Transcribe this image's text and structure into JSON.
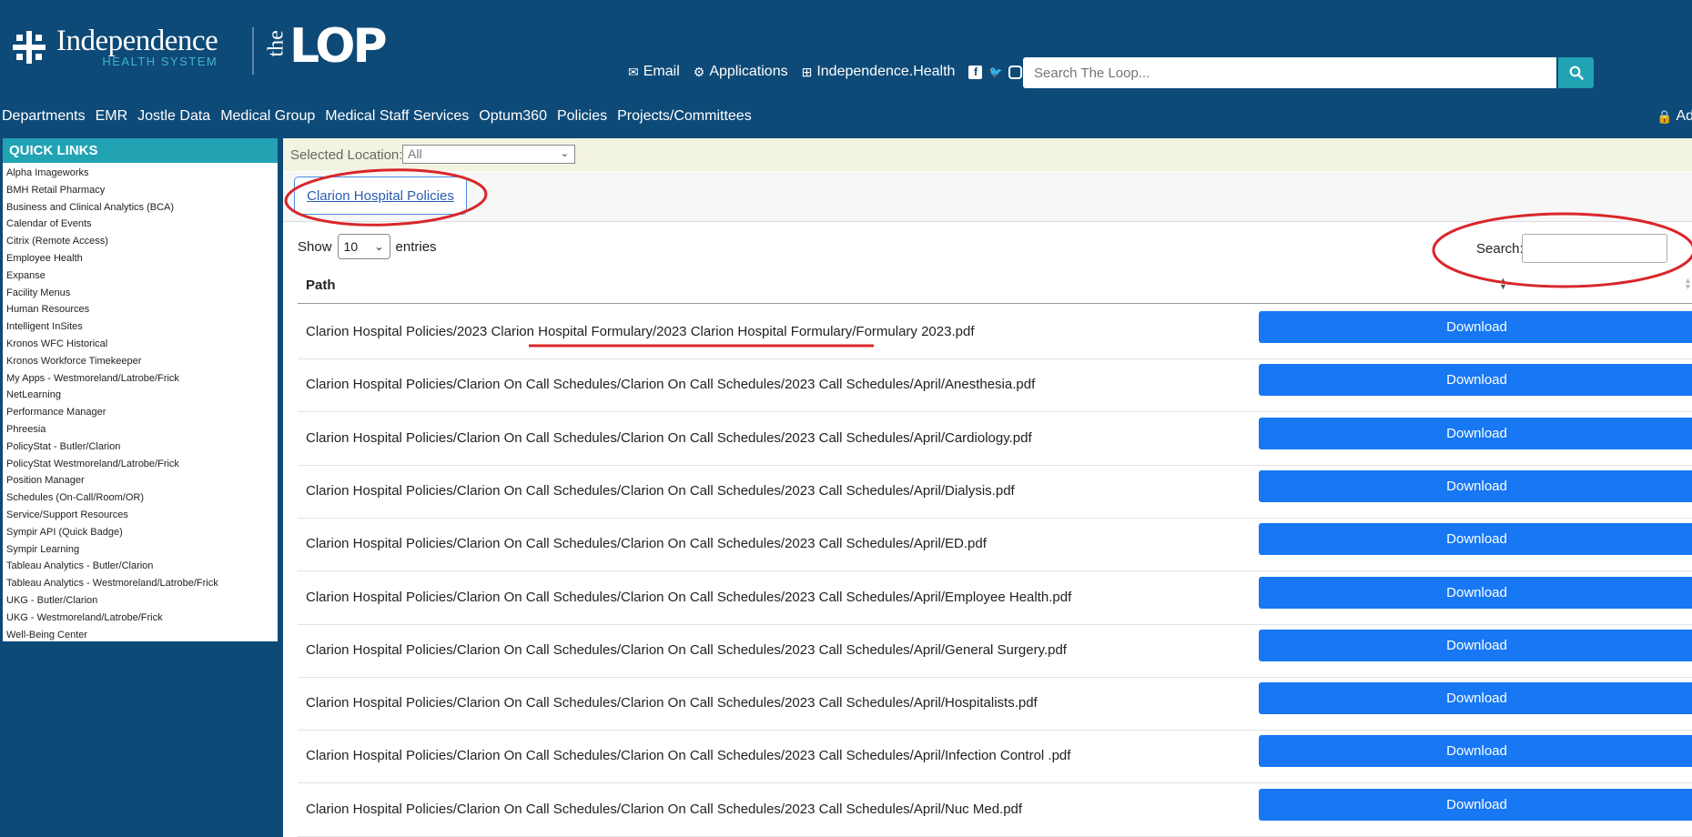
{
  "header": {
    "brand_name": "Independence",
    "brand_sub": "HEALTH SYSTEM",
    "loop_the": "the",
    "loop_word_a": "L",
    "loop_word_b": "OP",
    "links": {
      "email": "Email",
      "applications": "Applications",
      "independence_health": "Independence.Health"
    },
    "search_placeholder": "Search The Loop..."
  },
  "nav": {
    "items": [
      "Departments",
      "EMR",
      "Jostle Data",
      "Medical Group",
      "Medical Staff Services",
      "Optum360",
      "Policies",
      "Projects/Committees"
    ],
    "admin": "Ad"
  },
  "quick_links": {
    "title": "QUICK LINKS",
    "items": [
      "Alpha Imageworks",
      "BMH Retail Pharmacy",
      "Business and Clinical Analytics (BCA)",
      "Calendar of Events",
      "Citrix (Remote Access)",
      "Employee Health",
      "Expanse",
      "Facility Menus",
      "Human Resources",
      "Intelligent InSites",
      "Kronos WFC Historical",
      "Kronos Workforce Timekeeper",
      "My Apps - Westmoreland/Latrobe/Frick",
      "NetLearning",
      "Performance Manager",
      "Phreesia",
      "PolicyStat - Butler/Clarion",
      "PolicyStat Westmoreland/Latrobe/Frick",
      "Position Manager",
      "Schedules (On-Call/Room/OR)",
      "Service/Support Resources",
      "Sympir API (Quick Badge)",
      "Sympir Learning",
      "Tableau Analytics - Butler/Clarion",
      "Tableau Analytics - Westmoreland/Latrobe/Frick",
      "UKG - Butler/Clarion",
      "UKG - Westmoreland/Latrobe/Frick",
      "Well-Being Center"
    ]
  },
  "location": {
    "label": "Selected Location:",
    "value": "All"
  },
  "tab": {
    "label": "Clarion Hospital Policies"
  },
  "table": {
    "show_label": "Show",
    "entries_value": "10",
    "entries_label": "entries",
    "search_label": "Search:",
    "column_path": "Path",
    "download_label": "Download",
    "rows": [
      "Clarion Hospital Policies/2023 Clarion Hospital Formulary/2023 Clarion Hospital Formulary/Formulary 2023.pdf",
      "Clarion Hospital Policies/Clarion On Call Schedules/Clarion On Call Schedules/2023 Call Schedules/April/Anesthesia.pdf",
      "Clarion Hospital Policies/Clarion On Call Schedules/Clarion On Call Schedules/2023 Call Schedules/April/Cardiology.pdf",
      "Clarion Hospital Policies/Clarion On Call Schedules/Clarion On Call Schedules/2023 Call Schedules/April/Dialysis.pdf",
      "Clarion Hospital Policies/Clarion On Call Schedules/Clarion On Call Schedules/2023 Call Schedules/April/ED.pdf",
      "Clarion Hospital Policies/Clarion On Call Schedules/Clarion On Call Schedules/2023 Call Schedules/April/Employee Health.pdf",
      "Clarion Hospital Policies/Clarion On Call Schedules/Clarion On Call Schedules/2023 Call Schedules/April/General Surgery.pdf",
      "Clarion Hospital Policies/Clarion On Call Schedules/Clarion On Call Schedules/2023 Call Schedules/April/Hospitalists.pdf",
      "Clarion Hospital Policies/Clarion On Call Schedules/Clarion On Call Schedules/2023 Call Schedules/April/Infection Control .pdf",
      "Clarion Hospital Policies/Clarion On Call Schedules/Clarion On Call Schedules/2023 Call Schedules/April/Nuc Med.pdf"
    ]
  },
  "colors": {
    "header_bg": "#0e4a78",
    "accent_teal": "#21a3b4",
    "download_blue": "#1877f2",
    "annotation_red": "#d9262a"
  }
}
